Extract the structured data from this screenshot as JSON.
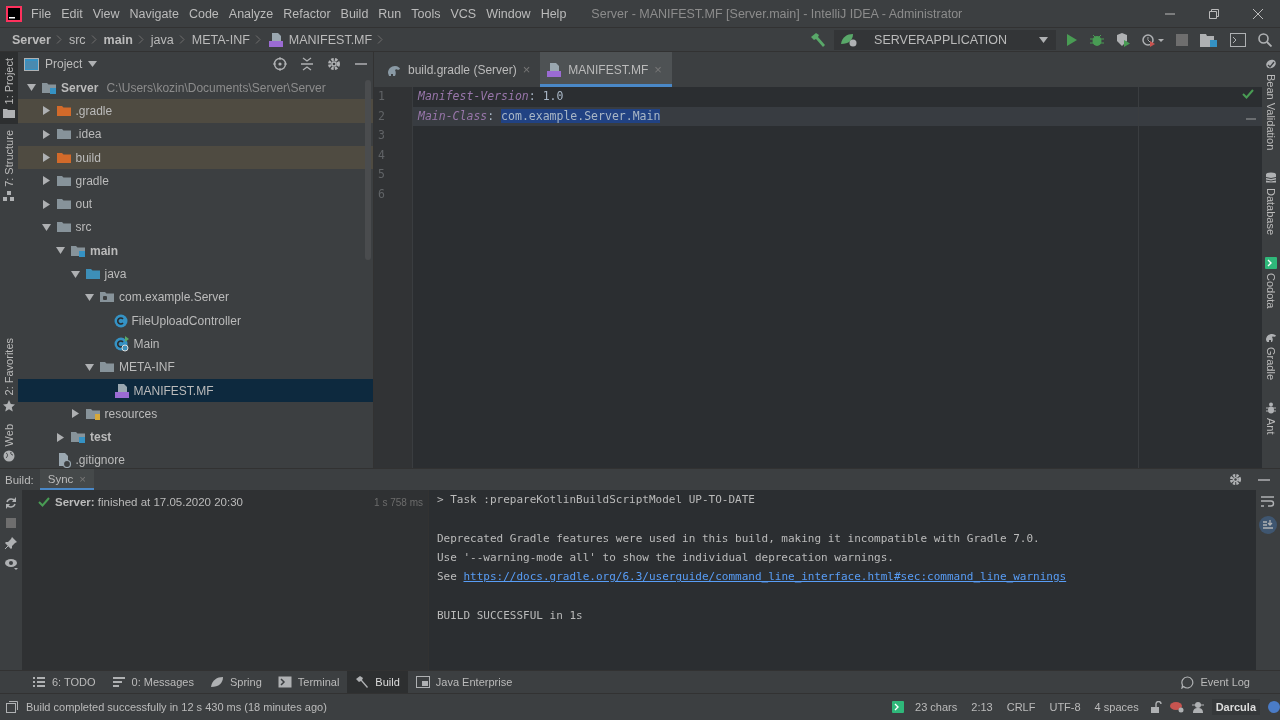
{
  "window": {
    "title": "Server - MANIFEST.MF [Server.main] - IntelliJ IDEA - Administrator"
  },
  "menu": [
    "File",
    "Edit",
    "View",
    "Navigate",
    "Code",
    "Analyze",
    "Refactor",
    "Build",
    "Run",
    "Tools",
    "VCS",
    "Window",
    "Help"
  ],
  "breadcrumbs": [
    {
      "label": "Server",
      "kind": "module"
    },
    {
      "label": "src",
      "kind": "folder"
    },
    {
      "label": "main",
      "kind": "module"
    },
    {
      "label": "java",
      "kind": "folder"
    },
    {
      "label": "META-INF",
      "kind": "folder"
    },
    {
      "label": "MANIFEST.MF",
      "kind": "manifest"
    }
  ],
  "run_config": {
    "label": "SERVERAPPLICATION"
  },
  "left_strip": {
    "top": [
      {
        "label": "1: Project",
        "kind": "project",
        "selected": true
      },
      {
        "label": "7: Structure",
        "kind": "structure",
        "selected": false
      }
    ],
    "bottom": [
      {
        "label": "2: Favorites",
        "kind": "favorites"
      },
      {
        "label": "Web",
        "kind": "web"
      }
    ]
  },
  "project": {
    "title": "Project",
    "tree": [
      {
        "label": "Server",
        "path": "C:\\Users\\kozin\\Documents\\Server\\Server",
        "kind": "module",
        "expanded": true,
        "selected": false,
        "children": [
          {
            "label": ".gradle",
            "kind": "excluded",
            "expanded": false,
            "selected": false
          },
          {
            "label": ".idea",
            "kind": "folder",
            "expanded": false,
            "selected": false
          },
          {
            "label": "build",
            "kind": "excluded",
            "expanded": false,
            "selected": false
          },
          {
            "label": "gradle",
            "kind": "folder",
            "expanded": false,
            "selected": false
          },
          {
            "label": "out",
            "kind": "folder",
            "expanded": false,
            "selected": false
          },
          {
            "label": "src",
            "kind": "folder",
            "expanded": true,
            "selected": false,
            "children": [
              {
                "label": "main",
                "kind": "module",
                "expanded": true,
                "selected": false,
                "children": [
                  {
                    "label": "java",
                    "kind": "source",
                    "expanded": true,
                    "selected": false,
                    "children": [
                      {
                        "label": "com.example.Server",
                        "kind": "package",
                        "expanded": true,
                        "selected": false,
                        "children": [
                          {
                            "label": "FileUploadController",
                            "kind": "class",
                            "selected": false
                          },
                          {
                            "label": "Main",
                            "kind": "main-class",
                            "selected": false
                          }
                        ]
                      },
                      {
                        "label": "META-INF",
                        "kind": "folder",
                        "expanded": true,
                        "selected": false,
                        "children": [
                          {
                            "label": "MANIFEST.MF",
                            "kind": "manifest",
                            "selected": true
                          }
                        ]
                      }
                    ]
                  },
                  {
                    "label": "resources",
                    "kind": "resources",
                    "expanded": false,
                    "selected": false
                  }
                ]
              },
              {
                "label": "test",
                "kind": "module",
                "expanded": false,
                "selected": false
              }
            ]
          },
          {
            "label": ".gitignore",
            "kind": "ignore",
            "selected": false
          }
        ]
      }
    ]
  },
  "editor": {
    "tabs": [
      {
        "label": "build.gradle (Server)",
        "kind": "gradle",
        "selected": false,
        "close": "×"
      },
      {
        "label": "MANIFEST.MF",
        "kind": "manifest",
        "selected": true,
        "close": "×"
      }
    ],
    "line_numbers": [
      "1",
      "2",
      "3",
      "4",
      "5",
      "6"
    ],
    "lines": [
      {
        "key": "Manifest-Version",
        "separator": ":",
        "value": "1.0",
        "current": false,
        "value_selected": false
      },
      {
        "key": "Main-Class",
        "separator": ":",
        "value": "com.example.Server.Main",
        "current": true,
        "value_selected": true
      }
    ]
  },
  "right_strip": [
    {
      "label": "Bean Validation",
      "kind": "bean"
    },
    {
      "label": "Database",
      "kind": "database"
    },
    {
      "label": "Codota",
      "kind": "codota"
    },
    {
      "label": "Gradle",
      "kind": "gradle"
    },
    {
      "label": "Ant",
      "kind": "ant"
    }
  ],
  "build": {
    "label": "Build:",
    "tabs": [
      {
        "label": "Sync",
        "selected": true,
        "close": "×"
      }
    ],
    "tree": [
      {
        "text": "**Server:** finished at 17.05.2020 20:30",
        "time": "1 s 758 ms"
      }
    ],
    "console": [
      {
        "kind": "text",
        "text": "> Task :prepareKotlinBuildScriptModel UP-TO-DATE"
      },
      {
        "kind": "blank"
      },
      {
        "kind": "text",
        "text": "Deprecated Gradle features were used in this build, making it incompatible with Gradle 7.0."
      },
      {
        "kind": "text",
        "text": "Use '--warning-mode all' to show the individual deprecation warnings."
      },
      {
        "kind": "link",
        "text": "See ",
        "link": "https://docs.gradle.org/6.3/userguide/command_line_interface.html#sec:command_line_warnings"
      },
      {
        "kind": "blank"
      },
      {
        "kind": "text",
        "text": "BUILD SUCCESSFUL in 1s"
      }
    ]
  },
  "tool_tabs": [
    {
      "label": "6: TODO",
      "kind": "todo",
      "selected": false
    },
    {
      "label": "0: Messages",
      "kind": "messages",
      "selected": false
    },
    {
      "label": "Spring",
      "kind": "spring",
      "selected": false
    },
    {
      "label": "Terminal",
      "kind": "terminal",
      "selected": false
    },
    {
      "label": "Build",
      "kind": "build",
      "selected": true
    },
    {
      "label": "Java Enterprise",
      "kind": "javaee",
      "selected": false
    }
  ],
  "event_log": "Event Log",
  "status_bar": {
    "message": "Build completed successfully in 12 s 430 ms (18 minutes ago)",
    "items": [
      "23 chars",
      "2:13",
      "CRLF",
      "UTF-8",
      "4 spaces"
    ],
    "theme": "Darcula"
  }
}
